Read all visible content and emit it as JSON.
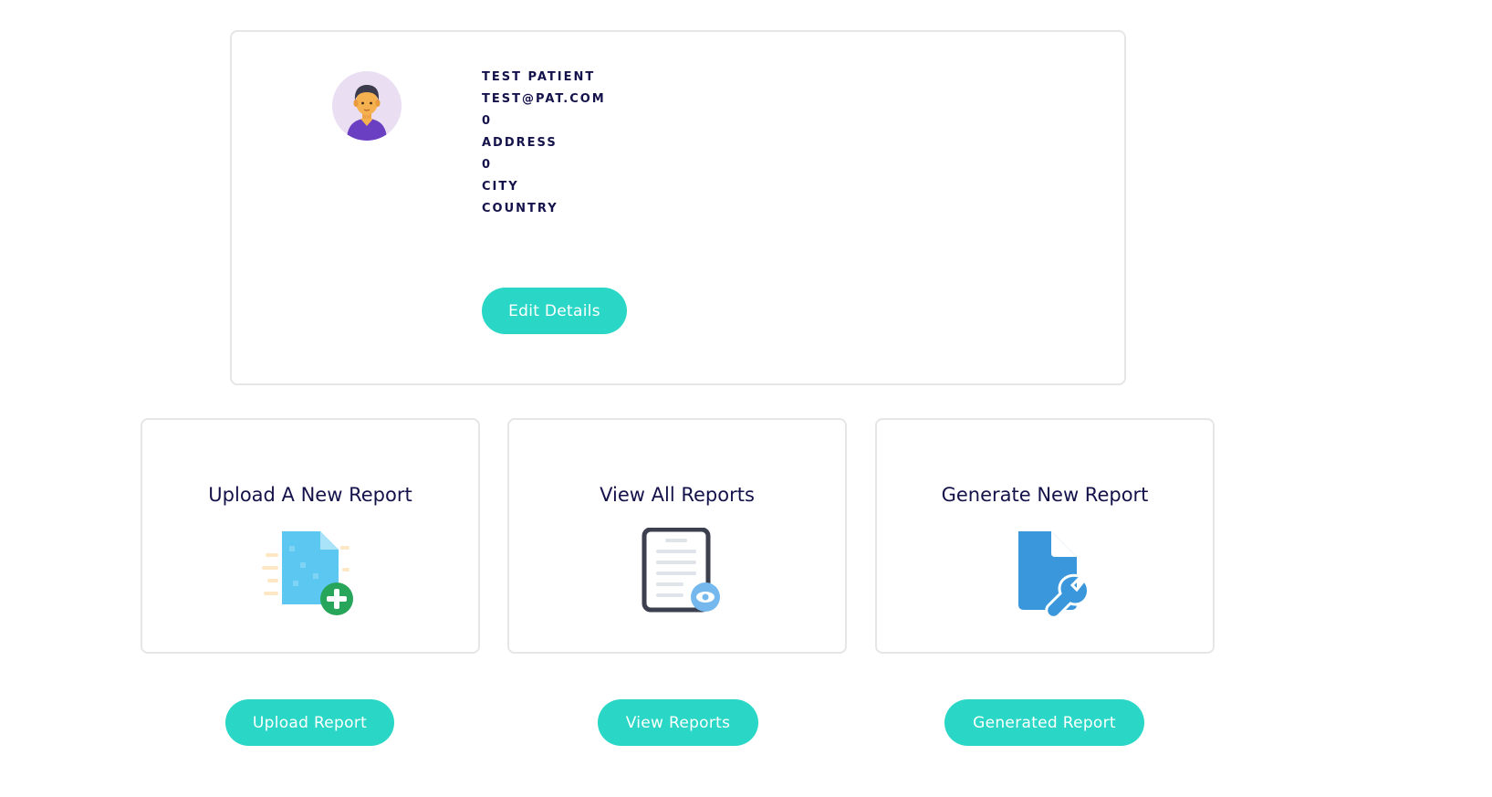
{
  "profile": {
    "name": "TEST PATIENT",
    "email": "TEST@PAT.COM",
    "phone": "0",
    "address": "ADDRESS",
    "zip": "0",
    "city": "CITY",
    "country": "COUNTRY",
    "avatar_icon": "user-avatar-icon",
    "edit_label": "Edit Details"
  },
  "cards": [
    {
      "title": "Upload A New Report",
      "icon": "file-add-icon",
      "button_label": "Upload Report"
    },
    {
      "title": "View All Reports",
      "icon": "file-view-icon",
      "button_label": "View Reports"
    },
    {
      "title": "Generate New Report",
      "icon": "file-wrench-icon",
      "button_label": "Generated Report"
    }
  ],
  "colors": {
    "accent": "#2ad7c6",
    "text": "#14124a",
    "border": "#e6e6e6"
  }
}
